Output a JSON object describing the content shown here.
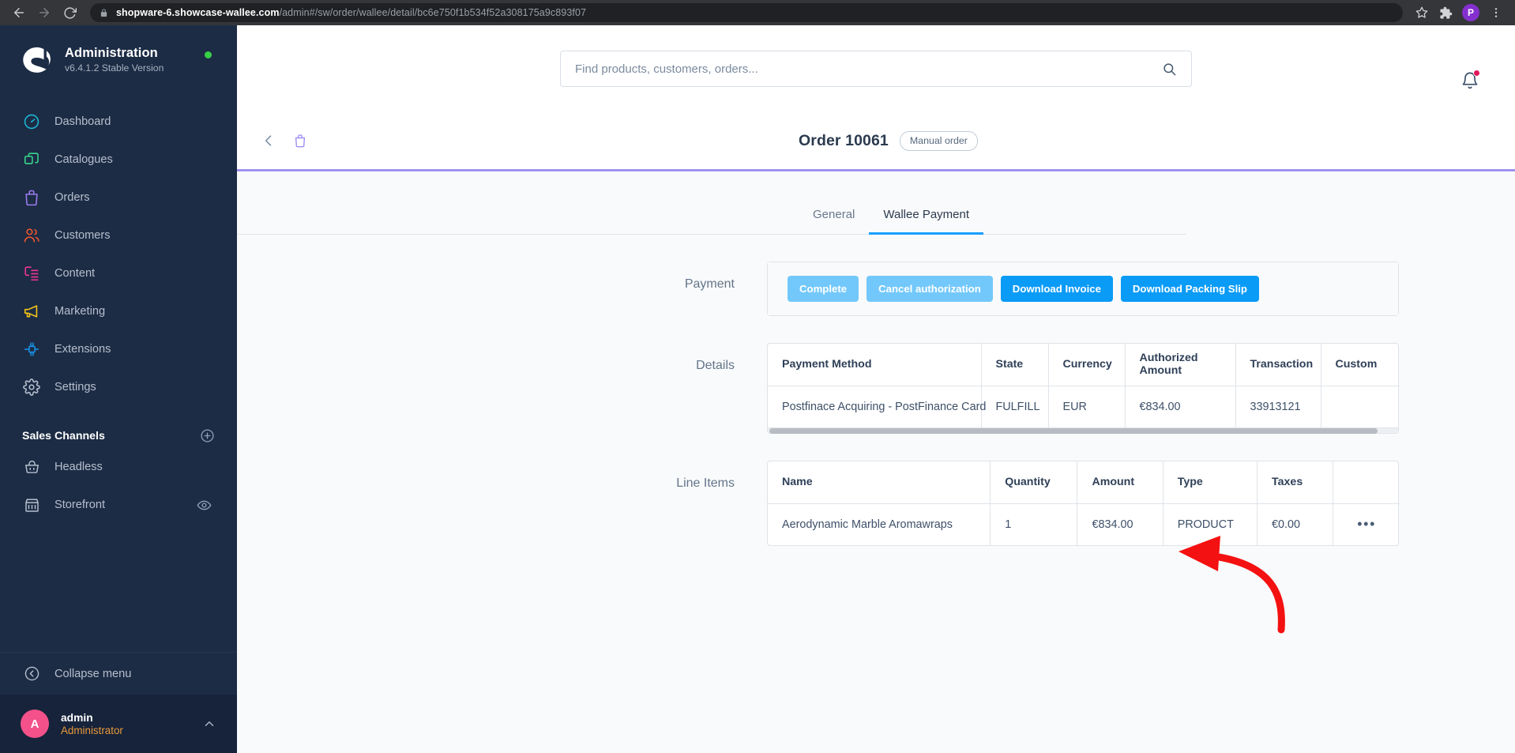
{
  "browser": {
    "back_icon": "arrow-left-icon",
    "forward_icon": "arrow-right-icon",
    "reload_icon": "reload-icon",
    "lock_icon": "lock-icon",
    "url_domain": "shopware-6.showcase-wallee.com",
    "url_path": "/admin#/sw/order/wallee/detail/bc6e750f1b534f52a308175a9c893f07",
    "bookmark_icon": "star-icon",
    "extensions_icon": "puzzle-icon",
    "profile_initial": "P",
    "menu_icon": "kebab-menu-icon"
  },
  "sidebar": {
    "brand": {
      "logo_icon": "shopware-logo",
      "title": "Administration",
      "version": "v6.4.1.2 Stable Version",
      "status_dot_color": "#37d046"
    },
    "items": [
      {
        "label": "Dashboard",
        "icon": "dashboard-icon",
        "color": "#1cb7d6"
      },
      {
        "label": "Catalogues",
        "icon": "catalogues-icon",
        "color": "#37d88b"
      },
      {
        "label": "Orders",
        "icon": "orders-icon",
        "color": "#9b7cf0"
      },
      {
        "label": "Customers",
        "icon": "customers-icon",
        "color": "#f2562f"
      },
      {
        "label": "Content",
        "icon": "content-icon",
        "color": "#f0368f"
      },
      {
        "label": "Marketing",
        "icon": "marketing-icon",
        "color": "#f5c518"
      },
      {
        "label": "Extensions",
        "icon": "extensions-icon",
        "color": "#1a93e8"
      },
      {
        "label": "Settings",
        "icon": "gear-icon",
        "color": "#b6bfcd"
      }
    ],
    "sales_channels": {
      "title": "Sales Channels",
      "add_icon": "plus-circle-icon",
      "items": [
        {
          "label": "Headless",
          "icon": "basket-icon",
          "trailing_icon": ""
        },
        {
          "label": "Storefront",
          "icon": "storefront-icon",
          "trailing_icon": "eye-icon"
        }
      ]
    },
    "collapse": {
      "label": "Collapse menu",
      "icon": "collapse-left-icon"
    },
    "user": {
      "avatar_initial": "A",
      "avatar_color": "#f4518b",
      "name": "admin",
      "role": "Administrator",
      "chevron_icon": "chevron-up-icon"
    }
  },
  "header": {
    "search_placeholder": "Find products, customers, orders...",
    "search_value": "",
    "search_icon": "search-icon",
    "notification_icon": "bell-icon",
    "notification_dot_color": "#e3175a"
  },
  "page": {
    "back_icon": "chevron-left-icon",
    "object_icon": "order-bag-icon",
    "title": "Order 10061",
    "badge": "Manual order",
    "accent_color": "#a092f0"
  },
  "tabs": [
    {
      "label": "General",
      "active": false
    },
    {
      "label": "Wallee Payment",
      "active": true
    }
  ],
  "sections": {
    "payment": {
      "label": "Payment",
      "buttons": [
        {
          "label": "Complete",
          "style": "muted"
        },
        {
          "label": "Cancel authorization",
          "style": "muted"
        },
        {
          "label": "Download Invoice",
          "style": "primary"
        },
        {
          "label": "Download Packing Slip",
          "style": "primary"
        }
      ]
    },
    "details": {
      "label": "Details",
      "columns": [
        "Payment Method",
        "State",
        "Currency",
        "Authorized Amount",
        "Transaction",
        "Custom"
      ],
      "rows": [
        {
          "payment_method": "Postfinace Acquiring - PostFinance Card",
          "state": "FULFILL",
          "currency": "EUR",
          "authorized_amount": "€834.00",
          "transaction": "33913121",
          "custom": ""
        }
      ],
      "scrollbar_icon": "horizontal-scrollbar"
    },
    "line_items": {
      "label": "Line Items",
      "columns": [
        "Name",
        "Quantity",
        "Amount",
        "Type",
        "Taxes",
        ""
      ],
      "rows": [
        {
          "name": "Aerodynamic Marble Aromawraps",
          "quantity": "1",
          "amount": "€834.00",
          "type": "PRODUCT",
          "taxes": "€0.00",
          "actions": "•••"
        }
      ]
    }
  },
  "annotation": {
    "arrow_icon": "red-curved-arrow",
    "color": "#f41111"
  }
}
